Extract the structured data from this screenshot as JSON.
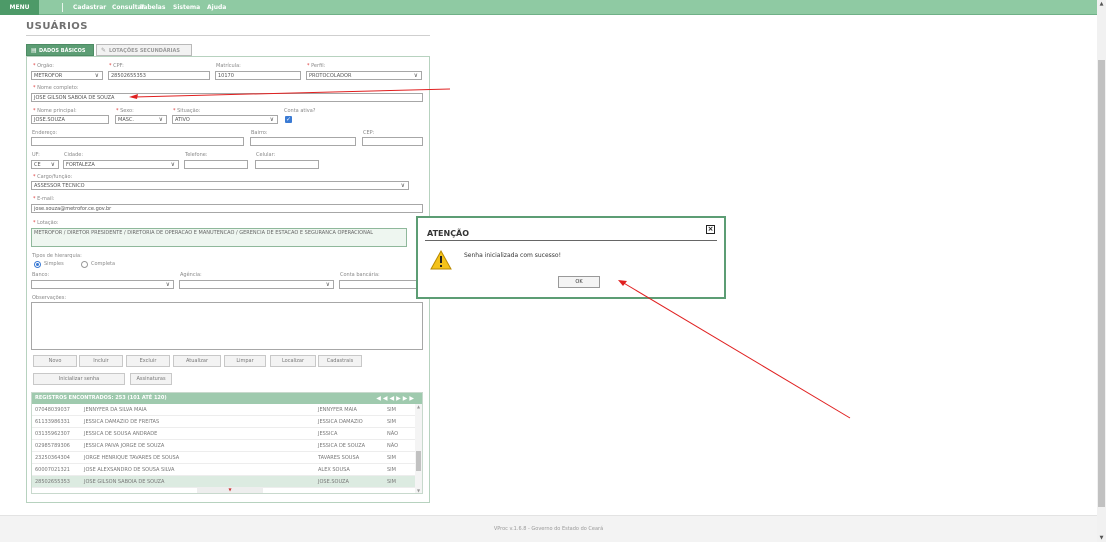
{
  "menubar": {
    "menu_label": "MENU",
    "items": [
      "Cadastrar",
      "Consultar",
      "Tabelas",
      "Sistema",
      "Ajuda"
    ]
  },
  "page": {
    "title": "USUÁRIOS"
  },
  "tabs": {
    "basic": "DADOS BÁSICOS",
    "secondary": "LOTAÇÕES SECUNDÁRIAS"
  },
  "form": {
    "orgao": {
      "label": "Orgão:",
      "value": "METROFOR"
    },
    "cpf": {
      "label": "CPF:",
      "value": "28502655353"
    },
    "matricula": {
      "label": "Matrícula:",
      "value": "10170"
    },
    "perfil": {
      "label": "Perfil:",
      "value": "PROTOCOLADOR"
    },
    "nome_completo": {
      "label": "Nome completo:",
      "value": "JOSE GILSON SABOIA DE SOUZA"
    },
    "nome_principal": {
      "label": "Nome principal:",
      "value": "JOSE.SOUZA"
    },
    "sexo": {
      "label": "Sexo:",
      "value": "MASC."
    },
    "situacao": {
      "label": "Situação:",
      "value": "ATIVO"
    },
    "conta_ativa": {
      "label": "Conta ativa?",
      "checked": true
    },
    "endereco": {
      "label": "Endereço:",
      "value": ""
    },
    "bairro": {
      "label": "Bairro:",
      "value": ""
    },
    "cep": {
      "label": "CEP:",
      "value": ""
    },
    "uf": {
      "label": "UF:",
      "value": "CE"
    },
    "cidade": {
      "label": "Cidade:",
      "value": "FORTALEZA"
    },
    "telefone": {
      "label": "Telefone:",
      "value": ""
    },
    "celular": {
      "label": "Celular:",
      "value": ""
    },
    "cargo": {
      "label": "Cargo/função:",
      "value": "ASSESSOR TECNICO"
    },
    "email": {
      "label": "E-mail:",
      "value": "jose.souza@metrofor.ce.gov.br"
    },
    "lotacao": {
      "label": "Lotação:",
      "value": "METROFOR / DIRETOR PRESIDENTE / DIRETORIA DE OPERACAO E MANUTENCAO / GERENCIA DE ESTACAO E SEGURANCA OPERACIONAL"
    },
    "hierarquia": {
      "label": "Tipos de hierarquia:",
      "opt_simples": "Simples",
      "opt_completa": "Completa",
      "selected": "Simples"
    },
    "banco": {
      "label": "Banco:",
      "value": ""
    },
    "agencia": {
      "label": "Agência:",
      "value": ""
    },
    "conta_bancaria": {
      "label": "Conta bancária:",
      "value": ""
    },
    "observacoes": {
      "label": "Observações:",
      "value": ""
    }
  },
  "buttons": {
    "novo": "Novo",
    "incluir": "Incluir",
    "excluir": "Excluir",
    "atualizar": "Atualizar",
    "limpar": "Limpar",
    "localizar": "Localizar",
    "cadastrais": "Cadastrais",
    "inicializar_senha": "Inicializar senha",
    "assinaturas": "Assinaturas"
  },
  "grid": {
    "header": "REGISTROS ENCONTRADOS: 253 (101 ATÉ 120)",
    "rows": [
      {
        "cpf": "07048039037",
        "nome": "JENNYFER DA SILVA MAIA",
        "login": "JENNYFER MAIA",
        "ativo": "SIM"
      },
      {
        "cpf": "61133986331",
        "nome": "JESSICA DAMAZIO DE FREITAS",
        "login": "JESSICA DAMAZIO",
        "ativo": "SIM"
      },
      {
        "cpf": "03135962307",
        "nome": "JESSICA DE SOUSA ANDRADE",
        "login": "JESSICA",
        "ativo": "NÃO"
      },
      {
        "cpf": "02985789306",
        "nome": "JESSICA PAIVA JORGE DE SOUZA",
        "login": "JESSICA DE SOUZA",
        "ativo": "NÃO"
      },
      {
        "cpf": "23250364304",
        "nome": "JORGE HENRIQUE TAVARES DE SOUSA",
        "login": "TAVARES SOUSA",
        "ativo": "SIM"
      },
      {
        "cpf": "60007021321",
        "nome": "JOSE ALEXSANDRO DE SOUSA SILVA",
        "login": "ALEX SOUSA",
        "ativo": "SIM"
      },
      {
        "cpf": "28502655353",
        "nome": "JOSE GILSON SABOIA DE SOUZA",
        "login": "JOSE.SOUZA",
        "ativo": "SIM"
      }
    ]
  },
  "dialog": {
    "title": "ATENÇÃO",
    "message": "Senha inicializada com sucesso!",
    "ok": "OK"
  },
  "footer": {
    "text": "VProc v.1.6.8 - Governo do Estado do Ceará"
  },
  "colors": {
    "accent": "#5c9d74",
    "menubar": "#8fcaa3",
    "annotation_arrow": "#e02020"
  }
}
